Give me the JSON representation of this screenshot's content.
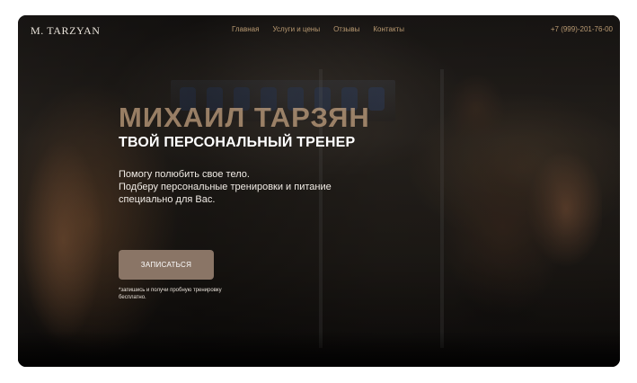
{
  "header": {
    "logo": "M. TARZYAN",
    "nav": [
      "Главная",
      "Услуги и цены",
      "Отзывы",
      "Контакты"
    ],
    "phone": "+7 (999)-201-76-00"
  },
  "hero": {
    "name": "МИХАИЛ ТАРЗЯН",
    "subtitle": "ТВОЙ ПЕРСОНАЛЬНЫЙ ТРЕНЕР",
    "description": [
      "Помогу полюбить свое тело.",
      "Подберу персональные тренировки и питание",
      "специально для Вас."
    ],
    "cta_label": "ЗАПИСАТЬСЯ",
    "note": "*запишись и получи пробную тренировку бесплатно."
  },
  "colors": {
    "accent": "#b99a72",
    "button": "#8a7566",
    "background": "#0f0d0b"
  }
}
